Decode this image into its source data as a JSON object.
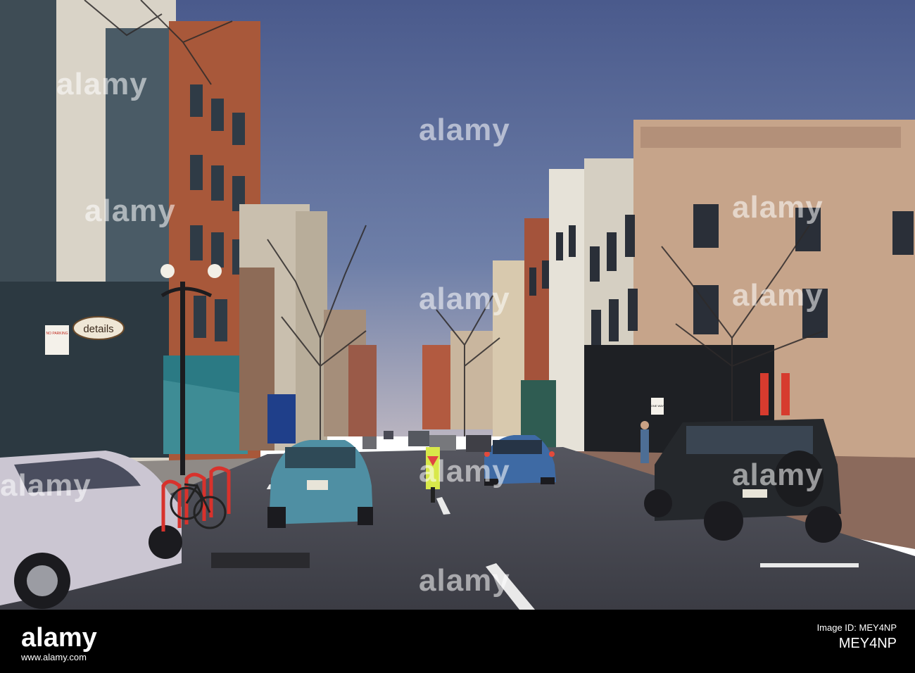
{
  "watermark": {
    "text_1": "alamy",
    "text_2": "alamy",
    "text_3": "alamy",
    "text_4": "alamy",
    "text_5": "alamy",
    "text_6": "alamy",
    "text_7": "alamy",
    "text_8": "alamy",
    "text_9": "alamy",
    "text_10": "alamy"
  },
  "scene_signs": {
    "details": "details",
    "no_parking": "NO PARKING",
    "one_way": "ONE WAY"
  },
  "footer": {
    "logo": "alamy",
    "url": "www.alamy.com",
    "image_id_label": "Image ID: MEY4NP",
    "image_id": "MEY4NP"
  },
  "colors": {
    "sky": "#4f5f8f",
    "footer_bg": "#000000"
  }
}
